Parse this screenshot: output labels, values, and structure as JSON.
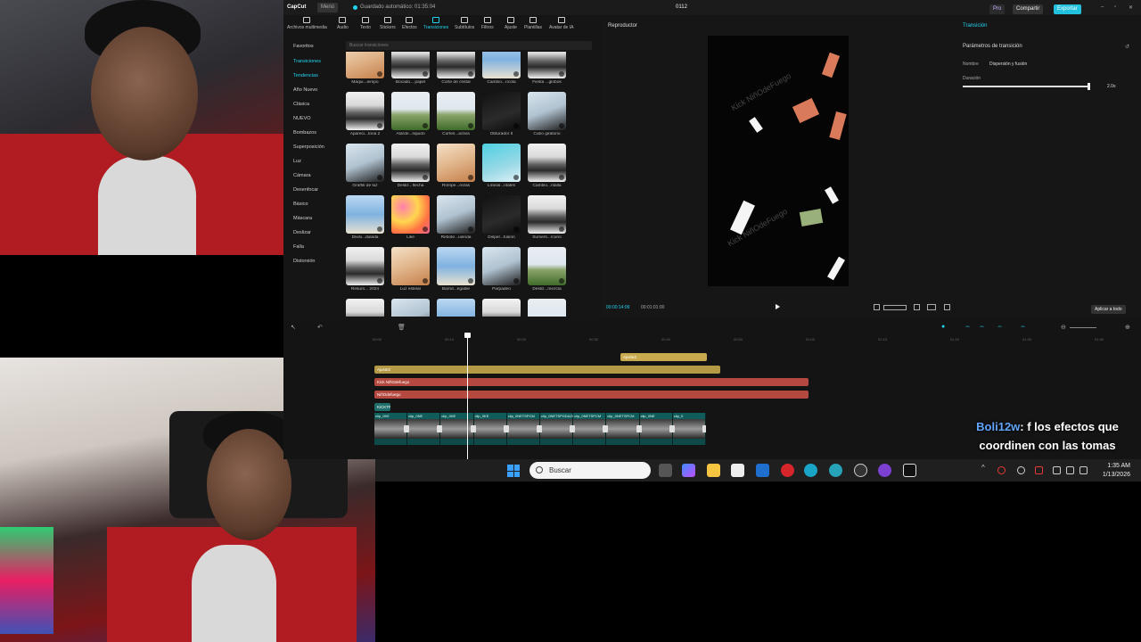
{
  "app": {
    "name": "CapCut",
    "menu_label": "Menú",
    "autosave": "Guardado automático: 01:35:04",
    "project_name": "0112",
    "pro_label": "Pro",
    "share_label": "Compartir",
    "export_label": "Exportar",
    "accent_color": "#22d3ee"
  },
  "toolbar": {
    "items": [
      {
        "label": "Archivos multimedia",
        "icon": "media-icon"
      },
      {
        "label": "Audio",
        "icon": "audio-icon"
      },
      {
        "label": "Texto",
        "icon": "text-icon"
      },
      {
        "label": "Stickers",
        "icon": "sticker-icon"
      },
      {
        "label": "Efectos",
        "icon": "effects-icon"
      },
      {
        "label": "Transiciones",
        "icon": "transitions-icon",
        "active": true
      },
      {
        "label": "Subtítulos",
        "icon": "subtitles-icon"
      },
      {
        "label": "Filtros",
        "icon": "filters-icon"
      },
      {
        "label": "Ajuste",
        "icon": "adjust-icon"
      },
      {
        "label": "Plantillas",
        "icon": "templates-icon"
      },
      {
        "label": "Avatar de IA",
        "icon": "avatar-icon"
      }
    ]
  },
  "leftnav": {
    "items": [
      "Favoritos",
      "Transiciones",
      "Tendencias",
      "Año Nuevo",
      "Clásica",
      "NUEVO",
      "Bombazos",
      "Superposición",
      "Luz",
      "Cámara",
      "Desenfocar",
      "Básico",
      "Máscara",
      "Deslizar",
      "Falla",
      "Distorsión"
    ]
  },
  "search": {
    "placeholder": "Buscar transiciones"
  },
  "transitions": [
    {
      "label": "Máqui...iempo",
      "style": "warm"
    },
    {
      "label": "Bocado... papel",
      "style": "mtn"
    },
    {
      "label": "Corte de cristal",
      "style": "mtn"
    },
    {
      "label": "Cambio...rícola",
      "style": "sky"
    },
    {
      "label": "Fiesta ...globos",
      "style": "mtn"
    },
    {
      "label": "Apareci...tona 2",
      "style": "mtn"
    },
    {
      "label": "Atarde...líquido",
      "style": "field"
    },
    {
      "label": "Cortes...activa",
      "style": "field"
    },
    {
      "label": "Obturador II",
      "style": "dark"
    },
    {
      "label": "Cubo giratorio",
      "style": "person"
    },
    {
      "label": "Graffiti de luz",
      "style": "person"
    },
    {
      "label": "Desliz...flecha",
      "style": "mtn"
    },
    {
      "label": "Rompe...rezas",
      "style": "warm"
    },
    {
      "label": "Líneas...ntales",
      "style": "teal"
    },
    {
      "label": "Cambio...ntalla",
      "style": "mtn"
    },
    {
      "label": "Divisi...dulada",
      "style": "sky"
    },
    {
      "label": "Like",
      "style": "flower"
    },
    {
      "label": "Rebote...uienda",
      "style": "person"
    },
    {
      "label": "Disper...fusión",
      "style": "dark"
    },
    {
      "label": "Sumers...rcurio",
      "style": "mtn"
    },
    {
      "label": "Resum... 2024",
      "style": "mtn"
    },
    {
      "label": "Luz estelar",
      "style": "warm"
    },
    {
      "label": "Barrid...egable",
      "style": "sky"
    },
    {
      "label": "Parpadeo",
      "style": "person"
    },
    {
      "label": "Desliz...mezcla",
      "style": "field"
    },
    {
      "label": "",
      "style": "mtn"
    },
    {
      "label": "",
      "style": "person"
    },
    {
      "label": "",
      "style": "sky"
    },
    {
      "label": "",
      "style": "mtn"
    },
    {
      "label": "",
      "style": "field"
    }
  ],
  "player": {
    "title": "Reproductor",
    "watermark": "Kick NiñOdeFuego",
    "watermark2": "Kick NiñOdeFuego",
    "current_time": "00:00:14:09",
    "total_time": "00:01:01:00"
  },
  "props": {
    "tab": "Transición",
    "section": "Parámetros de transición",
    "name_label": "Nombre",
    "name_value": "Dispersión y fusión",
    "duration_label": "Duración",
    "duration_value": "2.0s",
    "duration_fraction": 0.995,
    "apply_all": "Aplicar a todo"
  },
  "timeline": {
    "ruler": [
      "00:00",
      "00:10",
      "00:20",
      "00:30",
      "00:40",
      "00:50",
      "01:00",
      "01:10",
      "01:20",
      "01:30",
      "01:40",
      "01:50"
    ],
    "audio_clip": "Ajuste2",
    "track1": "Ajuste2",
    "track2": "Kick NiñOdefuego",
    "track3": "NiñOdefuego",
    "track4": "KiCKTR",
    "clip_labels": [
      "clip_0KE",
      "clip_0NE",
      "clip_0KE",
      "clip_0KE",
      "clip_0NETSPCM",
      "clip_0NETSPGDAZWA",
      "clip_0NETSPCM",
      "clip_0NETSPCM",
      "clip_0NE",
      "clip_0"
    ]
  },
  "chat": {
    "user": "Boli12w",
    "message": ": f los efectos que coordinen con las tomas"
  },
  "taskbar": {
    "search_placeholder": "Buscar",
    "time": "1:35 AM",
    "date": "1/13/2026"
  }
}
